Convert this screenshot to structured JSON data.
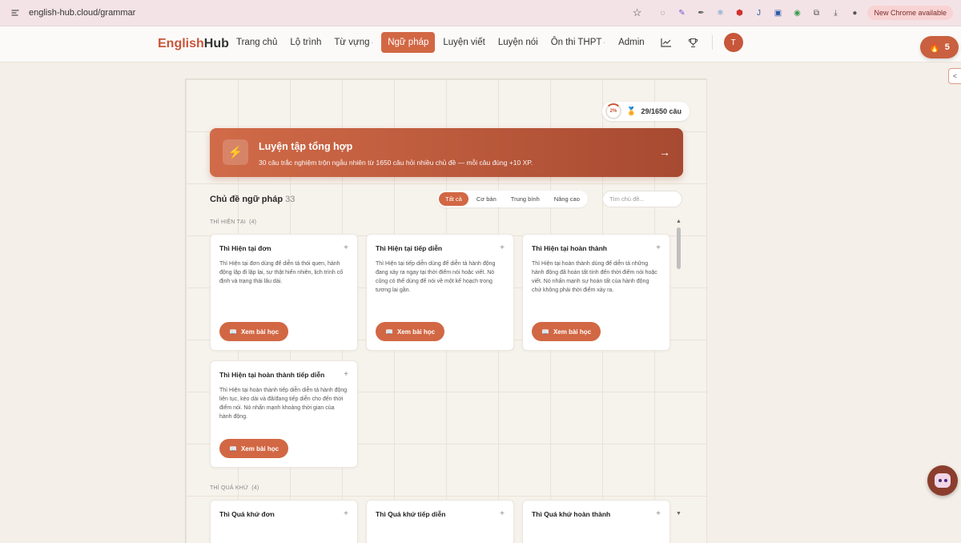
{
  "browser": {
    "url": "english-hub.cloud/grammar",
    "update_label": "New Chrome available"
  },
  "brand": {
    "name_a": "English",
    "name_b": "Hub"
  },
  "nav": {
    "items": [
      {
        "label": "Trang chủ"
      },
      {
        "label": "Lộ trình"
      },
      {
        "label": "Từ vựng",
        "dropdown": true
      },
      {
        "label": "Ngữ pháp",
        "active": true
      },
      {
        "label": "Luyện viết"
      },
      {
        "label": "Luyện nói"
      },
      {
        "label": "Ôn thi THPT",
        "dropdown": true
      },
      {
        "label": "Admin"
      }
    ],
    "caret": "·",
    "avatar_initial": "T",
    "streak_count": "5"
  },
  "progress": {
    "percent_label": "2%",
    "count_label": "29/1650 câu"
  },
  "practice_banner": {
    "title": "Luyện tập tổng hợp",
    "subtitle": "30 câu trắc nghiệm trộn ngẫu nhiên từ 1650 câu hỏi nhiều chủ đề — mỗi câu đúng +10 XP.",
    "arrow": "→"
  },
  "topics": {
    "title": "Chủ đề ngữ pháp",
    "count": "33",
    "filters": [
      "Tất cả",
      "Cơ bản",
      "Trung bình",
      "Nâng cao"
    ],
    "search_placeholder": "Tìm chủ đề..."
  },
  "groups": [
    {
      "label": "THÌ HIỆN TẠI",
      "count": "(4)",
      "cards": [
        {
          "title": "Thì Hiện tại đơn",
          "desc": "Thì Hiện tại đơn dùng để diễn tả thói quen, hành động lặp đi lặp lại, sự thật hiển nhiên, lịch trình cố định và trạng thái lâu dài."
        },
        {
          "title": "Thì Hiện tại tiếp diễn",
          "desc": "Thì Hiện tại tiếp diễn dùng để diễn tả hành động đang xảy ra ngay tại thời điểm nói hoặc viết. Nó cũng có thể dùng để nói về một kế hoạch trong tương lai gần."
        },
        {
          "title": "Thì Hiện tại hoàn thành",
          "desc": "Thì Hiện tại hoàn thành dùng để diễn tả những hành động đã hoàn tất tính đến thời điểm nói hoặc viết. Nó nhấn mạnh sự hoàn tất của hành động chứ không phải thời điểm xảy ra."
        },
        {
          "title": "Thì Hiện tại hoàn thành tiếp diễn",
          "desc": "Thì Hiện tại hoàn thành tiếp diễn diễn tả hành động liên tục, kéo dài và đã/đang tiếp diễn cho đến thời điểm nói. Nó nhấn mạnh khoảng thời gian của hành động."
        }
      ]
    },
    {
      "label": "THÌ QUÁ KHỨ",
      "count": "(4)",
      "cards": [
        {
          "title": "Thì Quá khứ đơn"
        },
        {
          "title": "Thì Quá khứ tiếp diễn"
        },
        {
          "title": "Thì Quá khứ hoàn thành"
        }
      ]
    }
  ],
  "card_button_label": "Xem bài học",
  "icons": {
    "bolt": "bolt-icon",
    "book": "book-icon",
    "flame": "flame-icon",
    "trophy": "trophy-icon",
    "chart": "chart-icon",
    "chatbot": "chatbot-icon"
  },
  "colors": {
    "accent": "#d26744",
    "banner_start": "#d16b48",
    "banner_end": "#a74a31"
  }
}
